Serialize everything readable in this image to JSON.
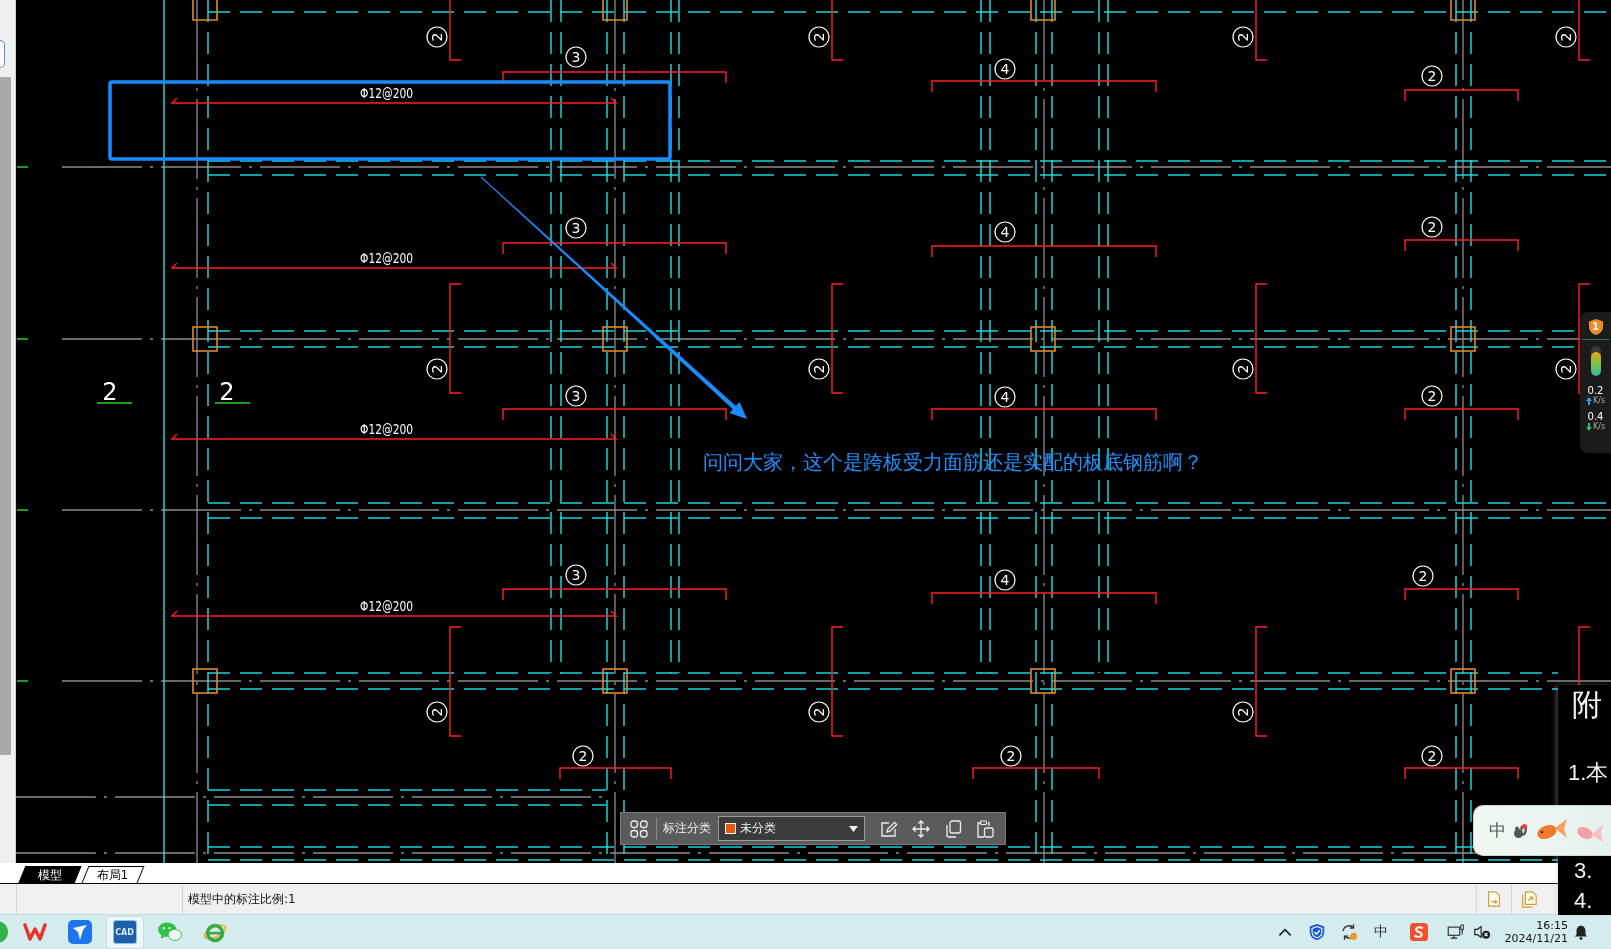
{
  "drawing": {
    "rebar_callouts": [
      "Φ12@200",
      "Φ12@200",
      "Φ12@200",
      "Φ12@200"
    ],
    "bar_marks": [
      {
        "text": "2",
        "kind": "rotated"
      },
      {
        "text": "2",
        "kind": "rotated"
      },
      {
        "text": "2",
        "kind": "rotated"
      },
      {
        "text": "2",
        "kind": "rotated"
      },
      {
        "text": "3",
        "kind": "upright"
      },
      {
        "text": "4",
        "kind": "upright"
      },
      {
        "text": "2",
        "kind": "upright"
      },
      {
        "text": "3",
        "kind": "upright"
      },
      {
        "text": "4",
        "kind": "upright"
      },
      {
        "text": "2",
        "kind": "upright"
      },
      {
        "text": "2",
        "kind": "rotated"
      },
      {
        "text": "2",
        "kind": "rotated"
      },
      {
        "text": "2",
        "kind": "rotated"
      },
      {
        "text": "2",
        "kind": "rotated"
      },
      {
        "text": "3",
        "kind": "upright"
      },
      {
        "text": "4",
        "kind": "upright"
      },
      {
        "text": "2",
        "kind": "upright"
      },
      {
        "text": "3",
        "kind": "upright"
      },
      {
        "text": "4",
        "kind": "upright"
      },
      {
        "text": "2",
        "kind": "upright"
      },
      {
        "text": "2",
        "kind": "rotated"
      },
      {
        "text": "2",
        "kind": "rotated"
      },
      {
        "text": "2",
        "kind": "rotated"
      },
      {
        "text": "2",
        "kind": "upright"
      },
      {
        "text": "2",
        "kind": "upright"
      },
      {
        "text": "2",
        "kind": "upright"
      }
    ],
    "span_labels": [
      "2",
      "2"
    ]
  },
  "annotation": {
    "text": "问问大家，这个是跨板受力面筋还是实配的板底钢筋啊？"
  },
  "network_meter": {
    "badge": "1",
    "gauge": {
      "level": 0.8
    },
    "upload": "0.2",
    "upload_unit": "K/s",
    "download": "0.4",
    "download_unit": "K/s"
  },
  "markup_toolbar": {
    "label": "标注分类",
    "category": "未分类"
  },
  "notes_window": {
    "lines": [
      "附",
      "1.本",
      "3.",
      "4."
    ]
  },
  "ime_widget": {
    "mode": "中"
  },
  "layout_tabs": [
    {
      "label": "模型",
      "selected": true
    },
    {
      "label": "布局1",
      "selected": false
    }
  ],
  "status_bar": {
    "text": "模型中的标注比例:1"
  },
  "taskbar": {
    "apps": [
      {
        "kind": "circle",
        "selected": false
      },
      {
        "kind": "zigzag",
        "selected": false
      },
      {
        "kind": "tile",
        "selected": false
      },
      {
        "kind": "cad",
        "label": "CAD",
        "selected": true
      },
      {
        "kind": "chat",
        "selected": false
      },
      {
        "kind": "ring",
        "selected": false
      }
    ],
    "input_mode": "中",
    "time": "16:15",
    "date": "2024/11/21"
  }
}
